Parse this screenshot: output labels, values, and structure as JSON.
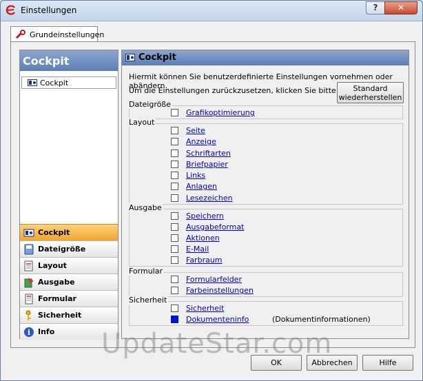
{
  "window": {
    "title": "Einstellungen",
    "help_glyph": "?",
    "close_glyph": "✕"
  },
  "tabs": [
    {
      "label": "Grundeinstellungen"
    }
  ],
  "left": {
    "header": "Cockpit",
    "selected_item": "Cockpit",
    "nav": [
      {
        "label": "Cockpit",
        "icon": "cockpit-icon",
        "active": true
      },
      {
        "label": "Dateigröße",
        "icon": "disk-icon"
      },
      {
        "label": "Layout",
        "icon": "layout-icon"
      },
      {
        "label": "Ausgabe",
        "icon": "output-icon"
      },
      {
        "label": "Formular",
        "icon": "form-icon"
      },
      {
        "label": "Sicherheit",
        "icon": "key-icon"
      },
      {
        "label": "Info",
        "icon": "info-icon"
      }
    ]
  },
  "right": {
    "title": "Cockpit",
    "desc1": "Hiermit können Sie benutzerdefinierte Einstellungen vornehmen oder abändern.",
    "desc2": "Um die Einstellungen zurückzusetzen, klicken Sie bitte hier:",
    "standard_button": [
      "Standard",
      "wiederherstellen"
    ],
    "groups": [
      {
        "label": "Dateigröße",
        "options": [
          {
            "label": "Grafikoptimierung"
          }
        ]
      },
      {
        "label": "Layout",
        "options": [
          {
            "label": "Seite"
          },
          {
            "label": "Anzeige"
          },
          {
            "label": "Schriftarten"
          },
          {
            "label": "Briefpapier"
          },
          {
            "label": "Links"
          },
          {
            "label": "Anlagen"
          },
          {
            "label": "Lesezeichen"
          }
        ]
      },
      {
        "label": "Ausgabe",
        "options": [
          {
            "label": "Speichern"
          },
          {
            "label": "Ausgabeformat"
          },
          {
            "label": "Aktionen"
          },
          {
            "label": "E-Mail"
          },
          {
            "label": "Farbraum"
          }
        ]
      },
      {
        "label": "Formular",
        "options": [
          {
            "label": "Formularfelder"
          },
          {
            "label": "Farbeinstellungen"
          }
        ]
      },
      {
        "label": "Sicherheit",
        "options": [
          {
            "label": "Sicherheit",
            "checked": false
          },
          {
            "label": "Dokumenteninfo",
            "checked": true,
            "note": "(Dokumentinformationen)"
          }
        ]
      }
    ]
  },
  "buttons": {
    "ok": "OK",
    "cancel": "Abbrechen",
    "help": "Hilfe"
  },
  "watermark": "UpdateStar.com",
  "colors": {
    "accent": "#f2a62a",
    "header": "#5d7fb6",
    "link": "#0000cc",
    "checked": "#0010d8"
  }
}
